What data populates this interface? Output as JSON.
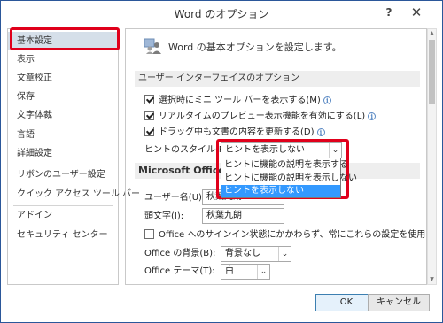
{
  "window": {
    "title": "Word のオプション",
    "help_glyph": "?",
    "close_glyph": "✕"
  },
  "sidebar": {
    "items": [
      {
        "label": "基本設定"
      },
      {
        "label": "表示"
      },
      {
        "label": "文章校正"
      },
      {
        "label": "保存"
      },
      {
        "label": "文字体裁"
      },
      {
        "label": "言語"
      },
      {
        "label": "詳細設定"
      },
      {
        "label": "リボンのユーザー設定"
      },
      {
        "label": "クイック アクセス ツール バー"
      },
      {
        "label": "アドイン"
      },
      {
        "label": "セキュリティ センター"
      }
    ]
  },
  "main": {
    "header_text": "Word の基本オプションを設定します。",
    "ui_section_title": "ユーザー インターフェイスのオプション",
    "options": [
      {
        "label": "選択時にミニ ツール バーを表示する(M)",
        "checked": true
      },
      {
        "label": "リアルタイムのプレビュー表示機能を有効にする(L)",
        "checked": true
      },
      {
        "label": "ドラッグ中も文書の内容を更新する(D)",
        "checked": true
      }
    ],
    "hint_style_label": "ヒントのスタイル(R):",
    "hint_style_value": "ヒントを表示しない",
    "hint_style_options": [
      "ヒントに機能の説明を表示する",
      "ヒントに機能の説明を表示しない",
      "ヒントを表示しない"
    ],
    "office_section_title": "Microsoft Office",
    "username_label": "ユーザー名(U):",
    "username_value": "秋葉九朗",
    "initials_label": "頭文字(I):",
    "initials_value": "秋葉九朗",
    "always_use_label": "Office へのサインイン状態にかかわらず、常にこれらの設定を使用する(A)",
    "always_use_checked": false,
    "background_label": "Office の背景(B):",
    "background_value": "背景なし",
    "theme_label": "Office テーマ(T):",
    "theme_value": "白"
  },
  "buttons": {
    "ok": "OK",
    "cancel": "キャンセル"
  },
  "colors": {
    "highlight_red": "#e0001b",
    "selection_blue": "#3399ff",
    "active_item": "#d5dfe9",
    "border_blue": "#2b579a"
  }
}
